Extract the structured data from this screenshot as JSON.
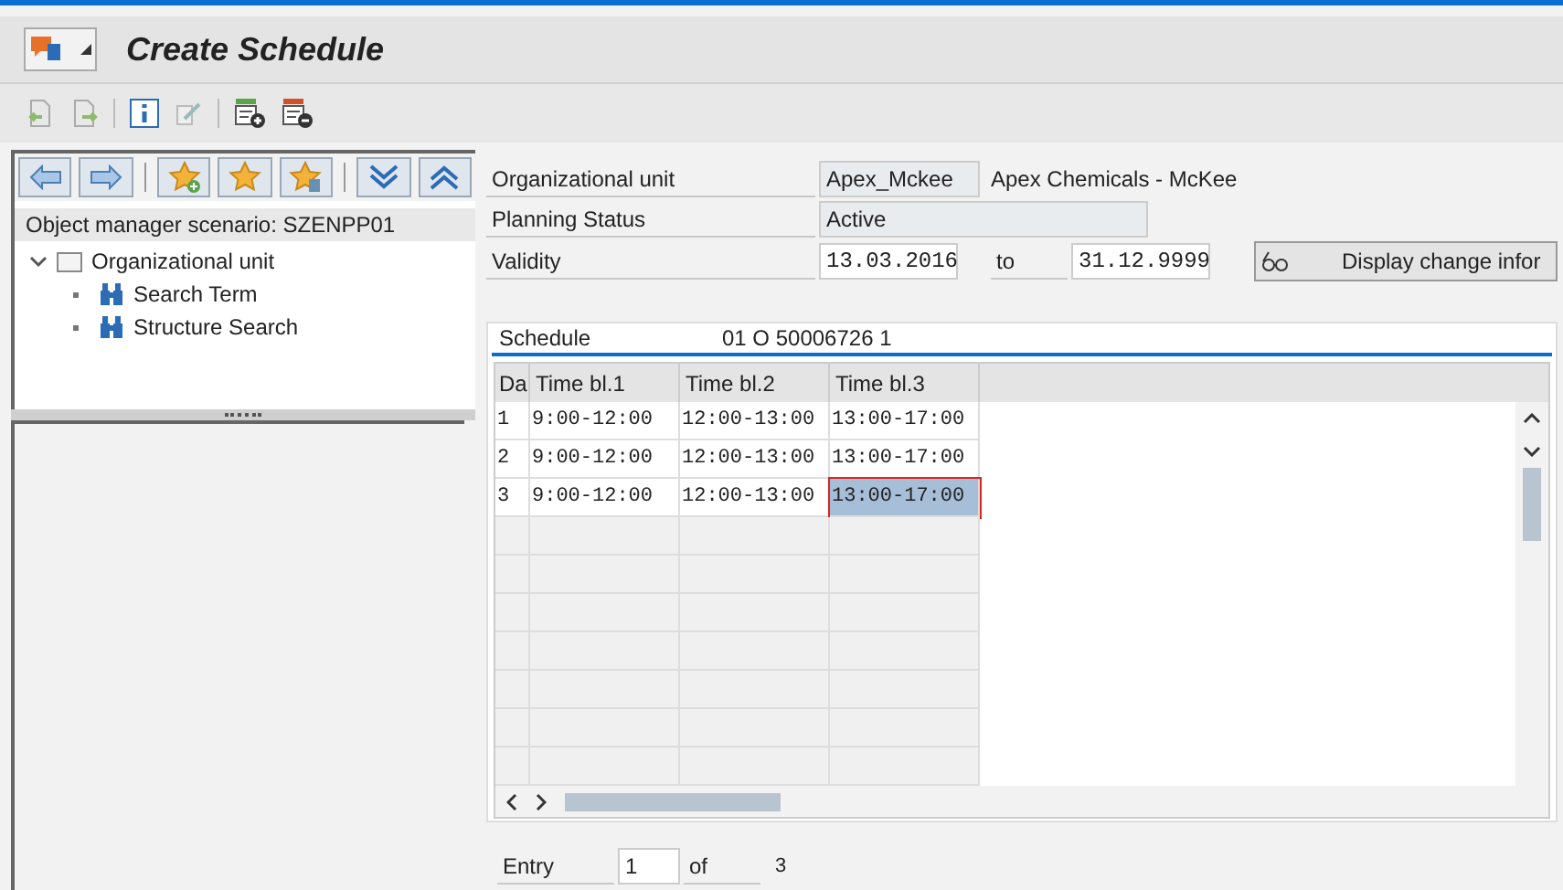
{
  "window": {
    "title": "Create Schedule"
  },
  "left_panel": {
    "scenario": "Object manager scenario: SZENPP01",
    "tree": [
      {
        "label": "Organizational unit",
        "kind": "folder",
        "expanded": true,
        "children": [
          {
            "label": "Search Term",
            "kind": "search"
          },
          {
            "label": "Structure Search",
            "kind": "search"
          }
        ]
      }
    ]
  },
  "form": {
    "org_unit": {
      "label": "Organizational unit",
      "value": "Apex_Mckee",
      "description": "Apex Chemicals - McKee"
    },
    "planning_status": {
      "label": "Planning Status",
      "value": "Active"
    },
    "validity": {
      "label": "Validity",
      "from": "13.03.2016",
      "to_label": "to",
      "to": "31.12.9999"
    },
    "change_button": "Display change infor"
  },
  "tab": {
    "label": "Schedule",
    "value": "01 O  50006726 1"
  },
  "table": {
    "columns": [
      "Da",
      "Time bl.1",
      "Time bl.2",
      "Time bl.3"
    ],
    "rows": [
      {
        "cells": [
          {
            "text": "1",
            "selected": false
          },
          {
            "text": "9:00-12:00",
            "selected": false
          },
          {
            "text": "12:00-13:00",
            "selected": false
          },
          {
            "text": "13:00-17:00",
            "selected": false
          }
        ]
      },
      {
        "cells": [
          {
            "text": "2",
            "selected": false
          },
          {
            "text": "9:00-12:00",
            "selected": false
          },
          {
            "text": "12:00-13:00",
            "selected": false
          },
          {
            "text": "13:00-17:00",
            "selected": false
          }
        ]
      },
      {
        "cells": [
          {
            "text": "3",
            "selected": false
          },
          {
            "text": "9:00-12:00",
            "selected": false
          },
          {
            "text": "12:00-13:00",
            "selected": false
          },
          {
            "text": "13:00-17:00",
            "selected": true
          }
        ]
      }
    ]
  },
  "entry": {
    "label": "Entry",
    "value": "1",
    "of_label": "of",
    "total": "3"
  }
}
